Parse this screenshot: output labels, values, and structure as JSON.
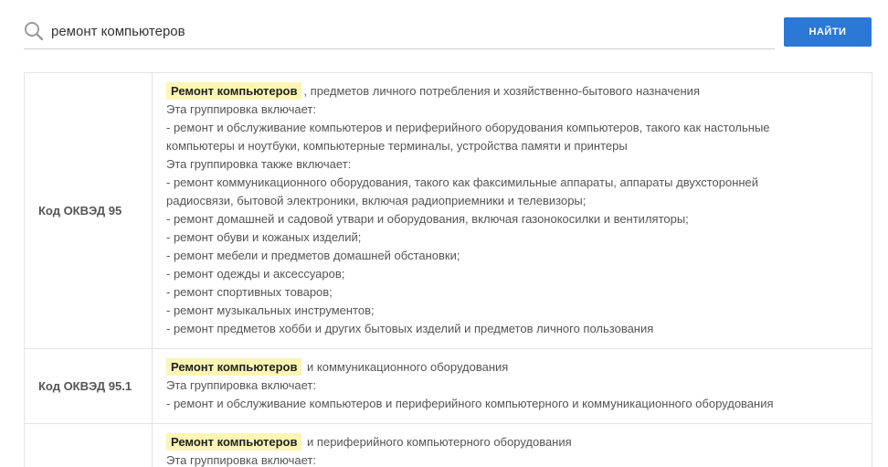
{
  "search": {
    "value": "ремонт компьютеров",
    "placeholder": "",
    "button_label": "НАЙТИ"
  },
  "results": [
    {
      "code": "Код ОКВЭД 95",
      "highlight": "Ремонт компьютеров",
      "title_rest": ", предметов личного потребления и хозяйственно-бытового назначения",
      "lines": [
        "Эта группировка включает:",
        "- ремонт и обслуживание компьютеров и периферийного оборудования компьютеров, такого как настольные",
        "компьютеры и ноутбуки, компьютерные терминалы, устройства памяти и принтеры",
        "Эта группировка также включает:",
        "- ремонт коммуникационного оборудования, такого как факсимильные аппараты, аппараты двухсторонней",
        "радиосвязи, бытовой электроники, включая радиоприемники и телевизоры;",
        "- ремонт домашней и садовой утвари и оборудования, включая газонокосилки и вентиляторы;",
        "- ремонт обуви и кожаных изделий;",
        "- ремонт мебели и предметов домашней обстановки;",
        "- ремонт одежды и аксессуаров;",
        "- ремонт спортивных товаров;",
        "- ремонт музыкальных инструментов;",
        "- ремонт предметов хобби и других бытовых изделий и предметов личного пользования"
      ]
    },
    {
      "code": "Код ОКВЭД 95.1",
      "highlight": "Ремонт компьютеров",
      "title_rest": " и коммуникационного оборудования",
      "lines": [
        "Эта группировка включает:",
        "- ремонт и обслуживание компьютеров и периферийного компьютерного и коммуникационного оборудования"
      ]
    },
    {
      "code": "",
      "highlight": "Ремонт компьютеров",
      "title_rest": " и периферийного компьютерного оборудования",
      "lines": [
        "Эта группировка включает:"
      ]
    }
  ],
  "colors": {
    "accent": "#2b78d7",
    "highlight": "#fbf6b4"
  },
  "icons": {
    "search": "search-icon"
  }
}
